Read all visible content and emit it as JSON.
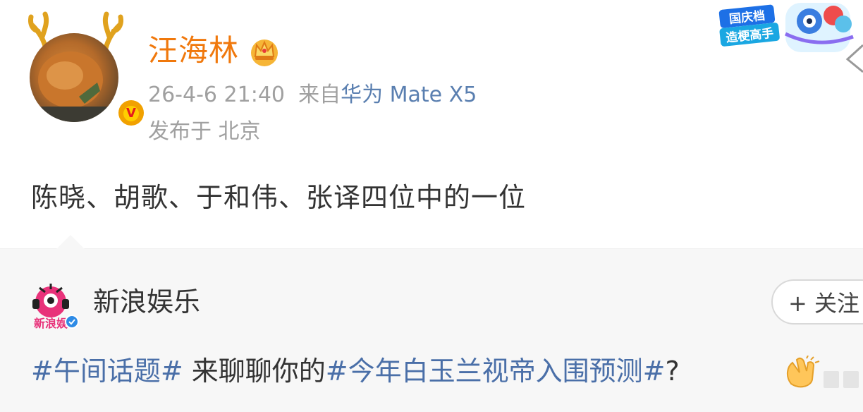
{
  "post": {
    "author": "汪海林",
    "timestamp": "26-4-6 21:40",
    "source_prefix": "来自",
    "device": "华为 Mate X5",
    "location_label": "发布于 北京",
    "content": "陈晓、胡歌、于和伟、张译四位中的一位",
    "badge_text_1": "国庆档",
    "badge_text_2": "造梗高手"
  },
  "repost": {
    "author": "新浪娱乐",
    "avatar_text": "新浪娱",
    "follow_label": "+ 关注",
    "topic1": "#午间话题#",
    "text_mid": " 来聊聊你的",
    "topic2": "#今年白玉兰视帝入围预测#",
    "text_end": "?"
  },
  "colors": {
    "author_orange": "#f0780c",
    "meta_gray": "#a0a0a0",
    "device_blue": "#5a7fb0",
    "topic_blue": "#4a6fa8",
    "repost_bg": "#f7f7f7"
  },
  "icons": [
    "antler-icon",
    "verified-v-icon",
    "crown-vip-icon",
    "national-day-badge-icon",
    "more-icon",
    "blue-verified-icon",
    "clap-emoji-icon"
  ]
}
